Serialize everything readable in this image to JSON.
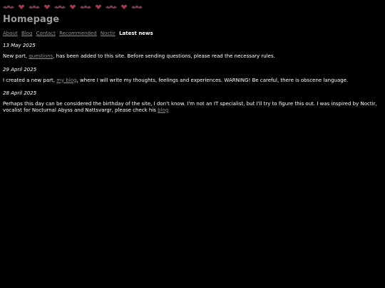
{
  "decoration": {
    "icons": [
      "bat-icon",
      "heart-icon",
      "bat-icon",
      "heart-icon",
      "bat-icon",
      "heart-icon",
      "bat-icon",
      "heart-icon",
      "bat-icon",
      "heart-icon",
      "bat-icon"
    ],
    "colors": {
      "bat": "#7a3f4f",
      "heart": "#a13a4a"
    }
  },
  "page": {
    "title": "Homepage"
  },
  "nav": {
    "items": [
      "About",
      "Blog",
      "Contact",
      "Recommended",
      "Noctir"
    ],
    "active": "Latest news"
  },
  "news": [
    {
      "date": "13 May 2025",
      "before": "New part, ",
      "link_text": "questions",
      "after": ", has been added to this site. Before sending questions, please read the necessary rules."
    },
    {
      "date": "29 April 2025",
      "before": "I created a new part, ",
      "link_text": "my blog",
      "after": ", where I will write my thoughts, feelings and experiences. WARNING! Be careful, there is obscene language."
    },
    {
      "date": "28 April 2025",
      "before": "Perhaps this day can be considered the birthday of the site, I don't know. I'm not an IT specialist, but I'll try to figure this out. I was inspired by Noctir, vocalist for Nocturnal Abyss and Nattsvargr, please check his ",
      "link_text": "blog",
      "after": ""
    }
  ]
}
